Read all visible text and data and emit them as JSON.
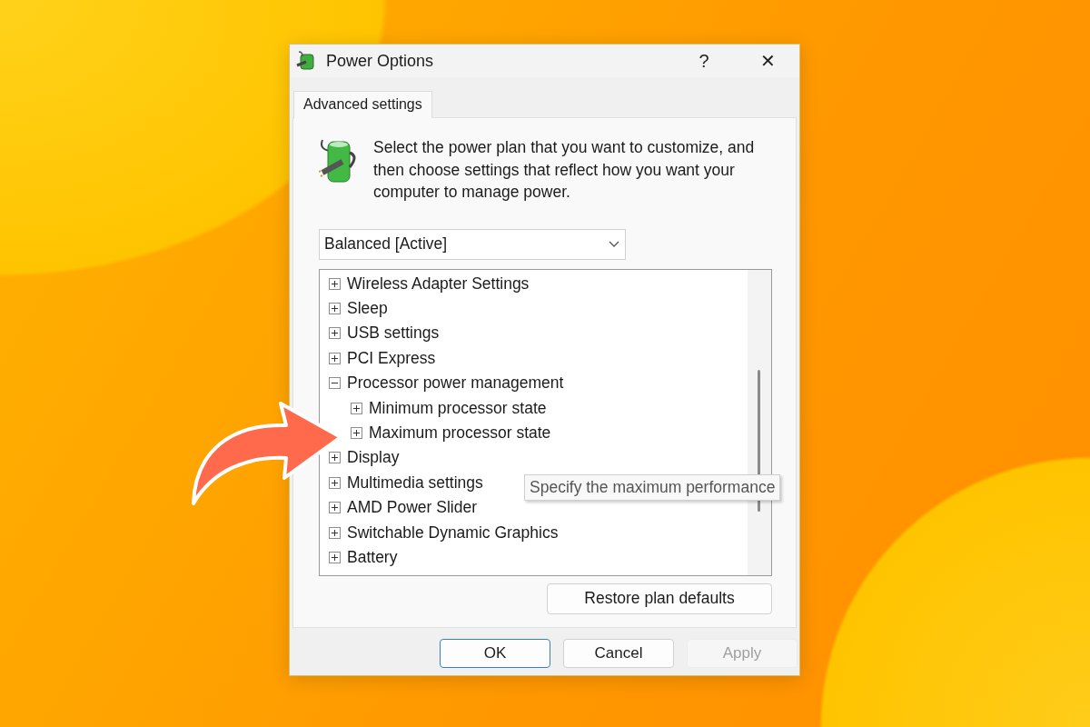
{
  "window": {
    "title": "Power Options"
  },
  "title_buttons": [
    "?",
    "✕"
  ],
  "tabs": [
    {
      "label": "Advanced settings",
      "selected": true
    }
  ],
  "intro": "Select the power plan that you want to customize, and then choose settings that reflect how you want your computer to manage power.",
  "plan_dropdown": {
    "value": "Balanced [Active]"
  },
  "tree": [
    {
      "label": "Wireless Adapter Settings",
      "expanded": false
    },
    {
      "label": "Sleep",
      "expanded": false
    },
    {
      "label": "USB settings",
      "expanded": false
    },
    {
      "label": "PCI Express",
      "expanded": false
    },
    {
      "label": "Processor power management",
      "expanded": true,
      "children": [
        {
          "label": "Minimum processor state",
          "expanded": false
        },
        {
          "label": "Maximum processor state",
          "expanded": false
        }
      ]
    },
    {
      "label": "Display",
      "expanded": false
    },
    {
      "label": "Multimedia settings",
      "expanded": false
    },
    {
      "label": "AMD Power Slider",
      "expanded": false
    },
    {
      "label": "Switchable Dynamic Graphics",
      "expanded": false
    },
    {
      "label": "Battery",
      "expanded": false
    }
  ],
  "tooltip": "Specify the maximum performance",
  "restore_button": "Restore plan defaults",
  "buttons": [
    {
      "label": "OK",
      "default": true,
      "disabled": false
    },
    {
      "label": "Cancel",
      "default": false,
      "disabled": false
    },
    {
      "label": "Apply",
      "default": false,
      "disabled": true
    }
  ]
}
